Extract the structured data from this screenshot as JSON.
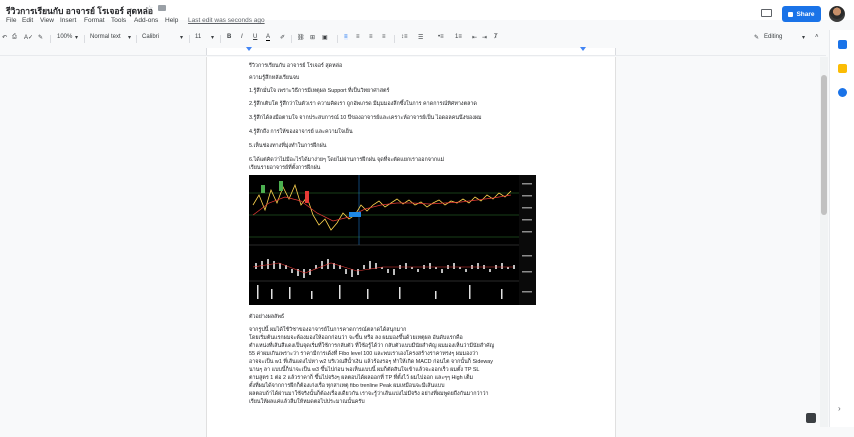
{
  "doc": {
    "title": "รีวิวการเรียนกับ อาจารย์ โรเจอร์ สุดหล่อ",
    "last_edit": "Last edit was seconds ago"
  },
  "menu": [
    "File",
    "Edit",
    "View",
    "Insert",
    "Format",
    "Tools",
    "Add-ons",
    "Help"
  ],
  "header": {
    "share_label": "Share"
  },
  "toolbar": {
    "zoom": "100%",
    "style": "Normal text",
    "font": "Calibri",
    "size": "11",
    "bold": "B",
    "italic": "I",
    "underline": "U",
    "text_color": "A",
    "mode": "Editing"
  },
  "content": {
    "lines": [
      "รีวิวการเรียนกับ อาจารย์ โรเจอร์ สุดหล่อ",
      "ความรู้สึกหลังเรียนจบ",
      "1.รู้สึกมั่นใจ เพราะวิธีการมีเหตุผล Support ที่เป็นวิทยาศาสตร์",
      "2.รู้สึกเติบโต รู้สึกว่าในตัวเรา ความคิดเรา ถูกอัพเกรด มีมุมมองลึกซึ้งในการ คาดการณ์ทิศทางตลาด",
      "3.รู้สึกได้ลงมือตามใจ จากประสบการณ์ 10 ปีของอาจารย์และเคราะห์อาจารย์เป็น ไอดอลคนนึงของผม",
      "4.รู้สึกถึง การให้ของอาจารย์ และความใจเย็น",
      "5.เห็นช่องทางที่มุ่งทำในการฝึกฝน",
      "6.ได้แต่คิดว่าไม่มีอะไรได้มาง่ายๆ โดยไม่ผ่านการฝึกฝน จุดที่จะตัดแยกเราออกจากแม่",
      "เรียนรายอาจารย์ที่ตั้งการฝึกฝน",
      "ตัวอย่างผลลัพธ์",
      "จากรูปนี้ ผมได้ใช้วิชาของอาจารย์ในการคาดการณ์ตลาดได้สนุกมาก",
      "โดยเริ่มต้นแรกผมจะต้องมองให้ออกก่อนว่า จะขึ้น หรือ ลง ผมมองขึ้นด้วยเหตุผล อันดับแรกคือ",
      "ตำแหน่งที่เส้นสีแดงเป็นจุดเริ่มที่ใช้การกลับตัว ที่ใช้อรู้ได้ว่า กลับตัวแบบมีนัยสำคัญ ผมมองเห็นว่ามีนัยสำคัญ",
      "55 ค่าผมเกินเพราะว่า ราคามีการเด้งที่ Fibo level 100 และพบเราเองโครงสร้างราคาทรงๆ ผมมองว่า",
      "อาจจะเป็น w1 ที่เส้นแดงไปหา w2 บริเวณสีน้ำเงิน แล้วร้องรอๆ ทำให้เกิด MACD ก่อนไต จากนั้นก็ Sideway",
      "นานๆ ลา แบบนี้ก็น่าจะเป็น w3 ขึ้นไปก่อน พอเห็นแบบนี้ ผมก็ตัดสินใจเข้าแล้วจะออกเร็ว ผมตั้ง TP SL",
      "ตามสูตร 1 ต่อ 2 แล้วราคาก็ ขึ้นไปจริงๆ ผลตอบได้ผลออกที่ TP ที่ตั้งไว้ ผมไปออก และๆๆ High เต็ม",
      "ตั้งที่ผมได้จากการฝึกก็ต้องเก่งเรื่อ ทุกสาเหตุ fibo trenline Peak ผมเหมือนจะมีเส้นแบบ",
      "ผลตอบถ้าได้ผ่านมาใช้จริงนั้นก็ต้องเรื่องเดียวกัน เราจะรู้ว่าเส้นแบ่งไม่มีจริง อย่างที่ผมพูดยถึงกันมากว่าว่า",
      "เรียนให้ผลแค่แล้วลืมให้หมดตอไปประมาณนั้นครับ"
    ]
  },
  "colors": {
    "accent": "#1a73e8",
    "chart_bg": "#000000",
    "chart_price": "#ffd54f",
    "chart_grid": "#2e7d32"
  }
}
